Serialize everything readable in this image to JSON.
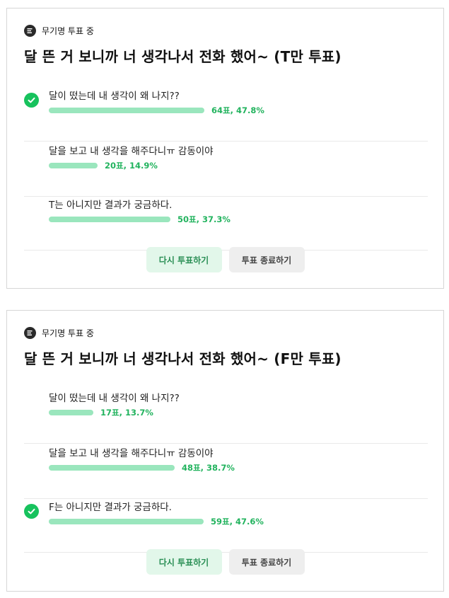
{
  "polls": [
    {
      "status": "무기명 투표 중",
      "title": "달 뜬 거 보니까 너 생각나서 전화 했어~ (T만 투표)",
      "options": [
        {
          "label": "달이 떴는데 내 생각이 왜 나지??",
          "stat": "64표, 47.8%",
          "fraction": 0.478,
          "selected": true
        },
        {
          "label": "달을 보고 내 생각을 해주다니ㅠ 감동이야",
          "stat": "20표, 14.9%",
          "fraction": 0.149,
          "selected": false
        },
        {
          "label": "T는 아니지만 결과가 궁금하다.",
          "stat": "50표, 37.3%",
          "fraction": 0.373,
          "selected": false
        }
      ],
      "revote_label": "다시 투표하기",
      "end_label": "투표 종료하기"
    },
    {
      "status": "무기명 투표 중",
      "title": "달 뜬 거 보니까 너 생각나서 전화 했어~ (F만 투표)",
      "options": [
        {
          "label": "달이 떴는데 내 생각이 왜 나지??",
          "stat": "17표, 13.7%",
          "fraction": 0.137,
          "selected": false
        },
        {
          "label": "달을 보고 내 생각을 해주다니ㅠ 감동이야",
          "stat": "48표, 38.7%",
          "fraction": 0.387,
          "selected": false
        },
        {
          "label": "F는 아니지만 결과가 궁금하다.",
          "stat": "59표, 47.6%",
          "fraction": 0.476,
          "selected": true
        }
      ],
      "revote_label": "다시 투표하기",
      "end_label": "투표 종료하기"
    }
  ],
  "colors": {
    "bar": "#9ae6bd",
    "accent": "#17c25d",
    "stat_text": "#22b35e"
  },
  "icons": {
    "status": "poll-icon",
    "selected": "check-circle-icon"
  }
}
